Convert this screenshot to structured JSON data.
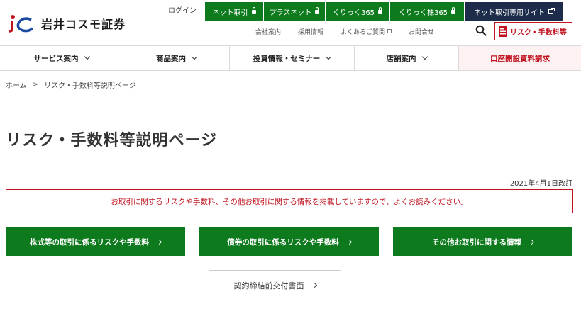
{
  "header": {
    "logo": {
      "mark": "iC",
      "text": "岩井コスモ証券"
    },
    "login": "ログイン",
    "top_buttons": [
      {
        "label": "ネット取引",
        "icon": "lock-icon"
      },
      {
        "label": "プラスネット",
        "icon": "lock-icon"
      },
      {
        "label": "くりっく365",
        "icon": "lock-icon"
      },
      {
        "label": "くりっく株365",
        "icon": "lock-icon"
      },
      {
        "label": "ネット取引専用サイト",
        "icon": "external-link-icon"
      }
    ],
    "sub_links": [
      {
        "label": "会社案内"
      },
      {
        "label": "採用情報"
      },
      {
        "label": "よくあるご質問",
        "icon": "external-link-icon"
      },
      {
        "label": "お問合せ"
      }
    ],
    "search_icon": "search-icon",
    "risk_button": {
      "label": "リスク・手数料等",
      "icon": "document-icon"
    }
  },
  "nav": {
    "items": [
      {
        "label": "サービス案内",
        "icon": "chevron-down-icon"
      },
      {
        "label": "商品案内",
        "icon": "chevron-down-icon"
      },
      {
        "label": "投資情報・セミナー",
        "icon": "chevron-down-icon"
      },
      {
        "label": "店舗案内",
        "icon": "chevron-down-icon"
      },
      {
        "label": "口座開設資料請求"
      }
    ]
  },
  "breadcrumb": {
    "home": "ホーム",
    "separator": ">",
    "current": "リスク・手数料等説明ページ"
  },
  "main": {
    "title": "リスク・手数料等説明ページ",
    "revised": "2021年4月1日改訂",
    "notice": "お取引に関するリスクや手数料、その他お取引に関する情報を掲載していますので、よくお読みください。",
    "buttons": [
      {
        "label": "株式等の取引に係るリスクや手数料"
      },
      {
        "label": "債券の取引に係るリスクや手数料"
      },
      {
        "label": "その他お取引に関する情報"
      }
    ],
    "contract_button": {
      "label": "契約締結前交付書面"
    }
  },
  "colors": {
    "brand_green": "#0e7a1e",
    "navy": "#1c2c4a",
    "accent_red": "#c1121f",
    "request_bg": "#fdf1f1"
  }
}
